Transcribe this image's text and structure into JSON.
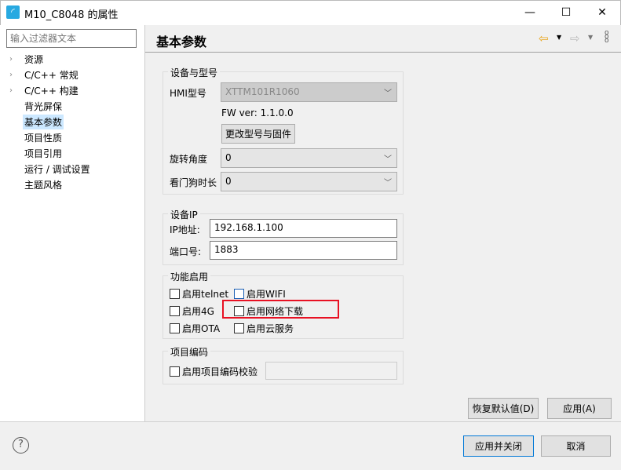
{
  "window": {
    "title": "M10_C8048 的属性",
    "minimize": "—",
    "maximize": "☐",
    "close": "✕"
  },
  "sidebar": {
    "filter_placeholder": "输入过滤器文本",
    "items": [
      {
        "label": "资源",
        "expandable": true
      },
      {
        "label": "C/C++ 常规",
        "expandable": true
      },
      {
        "label": "C/C++ 构建",
        "expandable": true
      },
      {
        "label": "背光屏保"
      },
      {
        "label": "基本参数",
        "selected": true
      },
      {
        "label": "项目性质"
      },
      {
        "label": "项目引用"
      },
      {
        "label": "运行 / 调试设置"
      },
      {
        "label": "主题风格"
      }
    ]
  },
  "page": {
    "title": "基本参数",
    "device": {
      "legend": "设备与型号",
      "hmi_label": "HMI型号",
      "hmi_value": "XTTM101R1060",
      "fw": "FW ver: 1.1.0.0",
      "change_btn": "更改型号与固件",
      "rotate_label": "旋转角度",
      "rotate_value": "0",
      "watchdog_label": "看门狗时长",
      "watchdog_value": "0"
    },
    "ip": {
      "legend": "设备IP",
      "ip_label": "IP地址:",
      "ip_value": "192.168.1.100",
      "port_label": "端口号:",
      "port_value": "1883"
    },
    "features": {
      "legend": "功能启用",
      "telnet": "启用telnet",
      "wifi": "启用WIFI",
      "g4": "启用4G",
      "netdl": "启用网络下载",
      "ota": "启用OTA",
      "cloud": "启用云服务"
    },
    "encoding": {
      "legend": "项目编码",
      "check": "启用项目编码校验",
      "value": ""
    },
    "restore_btn": "恢复默认值(D)",
    "apply_btn": "应用(A)"
  },
  "footer": {
    "help": "?",
    "apply_close": "应用并关闭",
    "cancel": "取消"
  },
  "colors": {
    "highlight": "#e81123",
    "selection": "#cce8ff",
    "back_arrow": "#e8a317"
  }
}
